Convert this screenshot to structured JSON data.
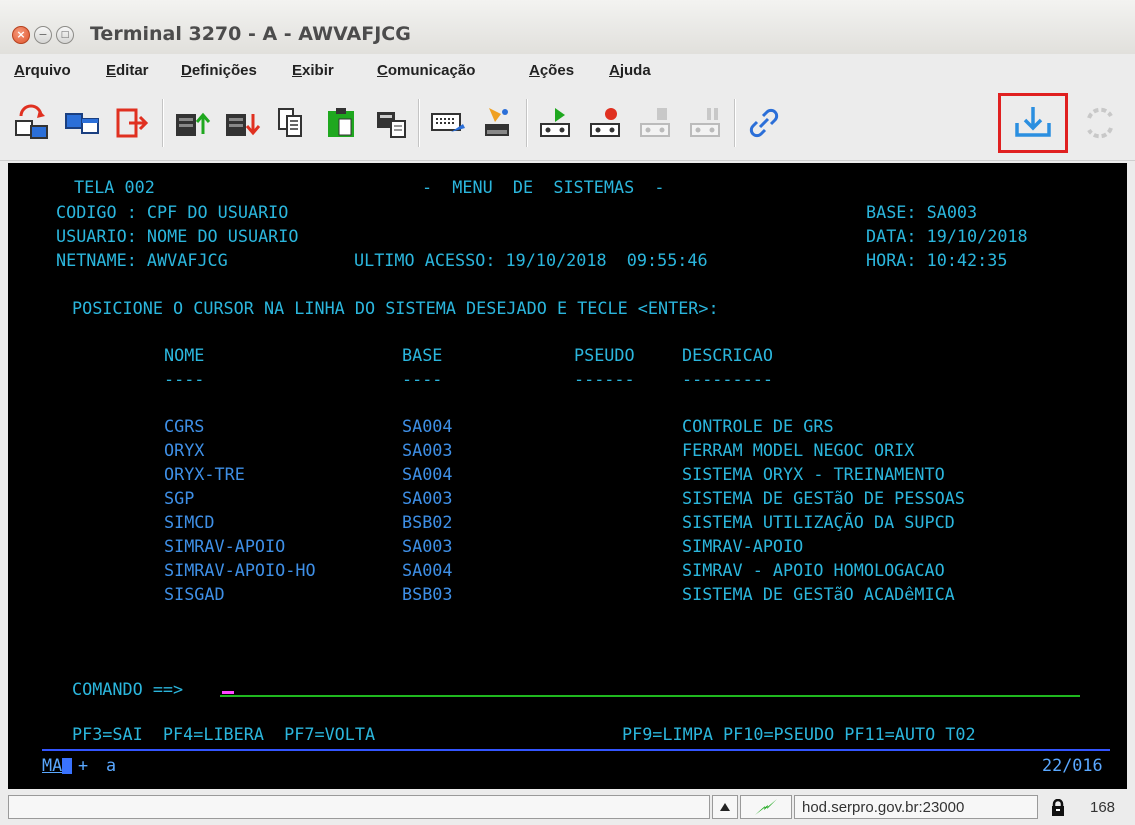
{
  "window": {
    "title": "Terminal 3270 - A - AWVAFJCG",
    "close_glyph": "×",
    "min_glyph": "−",
    "max_glyph": "□"
  },
  "menu": [
    "Arquivo",
    "Editar",
    "Definições",
    "Exibir",
    "Comunicação",
    "Ações",
    "Ajuda"
  ],
  "toolbar": {
    "icons": [
      "disconnect-icon",
      "connect-session-icon",
      "exit-icon",
      "send-file-icon",
      "receive-file-icon",
      "copy-icon",
      "paste-icon",
      "print-screen-icon",
      "keyboard-map-icon",
      "clear-icon",
      "play-macro-icon",
      "record-macro-icon",
      "stop-macro-icon",
      "pause-macro-icon",
      "link-icon",
      "download-icon",
      "refresh-icon"
    ],
    "highlight_color": "#e02020"
  },
  "terminal": {
    "header": {
      "tela": "TELA 002",
      "menu_title": "-  MENU  DE  SISTEMAS  -",
      "codigo": "CODIGO : CPF DO USUARIO",
      "base": "BASE: SA003",
      "usuario": "USUARIO: NOME DO USUARIO",
      "data": "DATA: 19/10/2018",
      "netname": "NETNAME: AWVAFJCG",
      "ultimo_acesso": "ULTIMO ACESSO: 19/10/2018  09:55:46",
      "hora": "HORA: 10:42:35"
    },
    "instruction": "POSICIONE O CURSOR NA LINHA DO SISTEMA DESEJADO E TECLE <ENTER>:",
    "columns": {
      "nome": "NOME",
      "base": "BASE",
      "pseudo": "PSEUDO",
      "descricao": "DESCRICAO",
      "nome_ul": "----",
      "base_ul": "----",
      "pseudo_ul": "------",
      "descricao_ul": "---------"
    },
    "rows": [
      {
        "nome": "CGRS",
        "base": "SA004",
        "descricao": "CONTROLE DE GRS"
      },
      {
        "nome": "ORYX",
        "base": "SA003",
        "descricao": "FERRAM MODEL NEGOC ORIX"
      },
      {
        "nome": "ORYX-TRE",
        "base": "SA004",
        "descricao": "SISTEMA ORYX - TREINAMENTO"
      },
      {
        "nome": "SGP",
        "base": "SA003",
        "descricao": "SISTEMA DE GESTãO DE PESSOAS"
      },
      {
        "nome": "SIMCD",
        "base": "BSB02",
        "descricao": "SISTEMA UTILIZAÇÃO DA SUPCD"
      },
      {
        "nome": "SIMRAV-APOIO",
        "base": "SA003",
        "descricao": "SIMRAV-APOIO"
      },
      {
        "nome": "SIMRAV-APOIO-HO",
        "base": "SA004",
        "descricao": "SIMRAV - APOIO HOMOLOGACAO"
      },
      {
        "nome": "SISGAD",
        "base": "BSB03",
        "descricao": "SISTEMA DE GESTãO ACADêMICA"
      }
    ],
    "comando_label": "COMANDO ==>",
    "comando_value": "",
    "pf_left": "PF3=SAI  PF4=LIBERA  PF7=VOLTA",
    "pf_right": "PF9=LIMPA PF10=PSEUDO PF11=AUTO T02",
    "oia_left": "MA",
    "oia_plus": "+",
    "oia_a": "a",
    "cursor_pos": "22/016"
  },
  "statusbar": {
    "host": "hod.serpro.gov.br:23000",
    "count": "168"
  }
}
